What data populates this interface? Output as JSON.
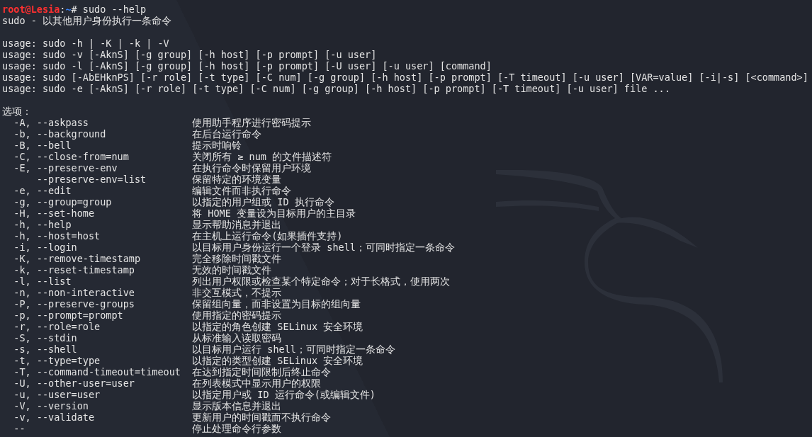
{
  "prompt": {
    "user_host": "root@Lesia",
    "separator": ":",
    "path": "~",
    "symbol": "#",
    "command": "sudo --help"
  },
  "title_line": "sudo - 以其他用户身份执行一条命令",
  "usage_lines": [
    "usage: sudo -h | -K | -k | -V",
    "usage: sudo -v [-AknS] [-g group] [-h host] [-p prompt] [-u user]",
    "usage: sudo -l [-AknS] [-g group] [-h host] [-p prompt] [-U user] [-u user] [command]",
    "usage: sudo [-AbEHknPS] [-r role] [-t type] [-C num] [-g group] [-h host] [-p prompt] [-T timeout] [-u user] [VAR=value] [-i|-s] [<command>]",
    "usage: sudo -e [-AknS] [-r role] [-t type] [-C num] [-g group] [-h host] [-p prompt] [-T timeout] [-u user] file ..."
  ],
  "options_heading": "选项：",
  "options": [
    {
      "flag": "-A, --askpass",
      "description": "使用助手程序进行密码提示"
    },
    {
      "flag": "-b, --background",
      "description": "在后台运行命令"
    },
    {
      "flag": "-B, --bell",
      "description": "提示时响铃"
    },
    {
      "flag": "-C, --close-from=num",
      "description": "关闭所有 ≥ num 的文件描述符"
    },
    {
      "flag": "-E, --preserve-env",
      "description": "在执行命令时保留用户环境"
    },
    {
      "flag": "    --preserve-env=list",
      "description": "保留特定的环境变量"
    },
    {
      "flag": "-e, --edit",
      "description": "编辑文件而非执行命令"
    },
    {
      "flag": "-g, --group=group",
      "description": "以指定的用户组或 ID 执行命令"
    },
    {
      "flag": "-H, --set-home",
      "description": "将 HOME 变量设为目标用户的主目录"
    },
    {
      "flag": "-h, --help",
      "description": "显示帮助消息并退出"
    },
    {
      "flag": "-h, --host=host",
      "description": "在主机上运行命令(如果插件支持)"
    },
    {
      "flag": "-i, --login",
      "description": "以目标用户身份运行一个登录 shell；可同时指定一条命令"
    },
    {
      "flag": "-K, --remove-timestamp",
      "description": "完全移除时间戳文件"
    },
    {
      "flag": "-k, --reset-timestamp",
      "description": "无效的时间戳文件"
    },
    {
      "flag": "-l, --list",
      "description": "列出用户权限或检查某个特定命令；对于长格式，使用两次"
    },
    {
      "flag": "-n, --non-interactive",
      "description": "非交互模式，不提示"
    },
    {
      "flag": "-P, --preserve-groups",
      "description": "保留组向量，而非设置为目标的组向量"
    },
    {
      "flag": "-p, --prompt=prompt",
      "description": "使用指定的密码提示"
    },
    {
      "flag": "-r, --role=role",
      "description": "以指定的角色创建 SELinux 安全环境"
    },
    {
      "flag": "-S, --stdin",
      "description": "从标准输入读取密码"
    },
    {
      "flag": "-s, --shell",
      "description": "以目标用户运行 shell；可同时指定一条命令"
    },
    {
      "flag": "-t, --type=type",
      "description": "以指定的类型创建 SELinux 安全环境"
    },
    {
      "flag": "-T, --command-timeout=timeout",
      "description": "在达到指定时间限制后终止命令"
    },
    {
      "flag": "-U, --other-user=user",
      "description": "在列表模式中显示用户的权限"
    },
    {
      "flag": "-u, --user=user",
      "description": "以指定用户或 ID 运行命令(或编辑文件)"
    },
    {
      "flag": "-V, --version",
      "description": "显示版本信息并退出"
    },
    {
      "flag": "-v, --validate",
      "description": "更新用户的时间戳而不执行命令"
    },
    {
      "flag": "--",
      "description": "停止处理命令行参数"
    }
  ]
}
